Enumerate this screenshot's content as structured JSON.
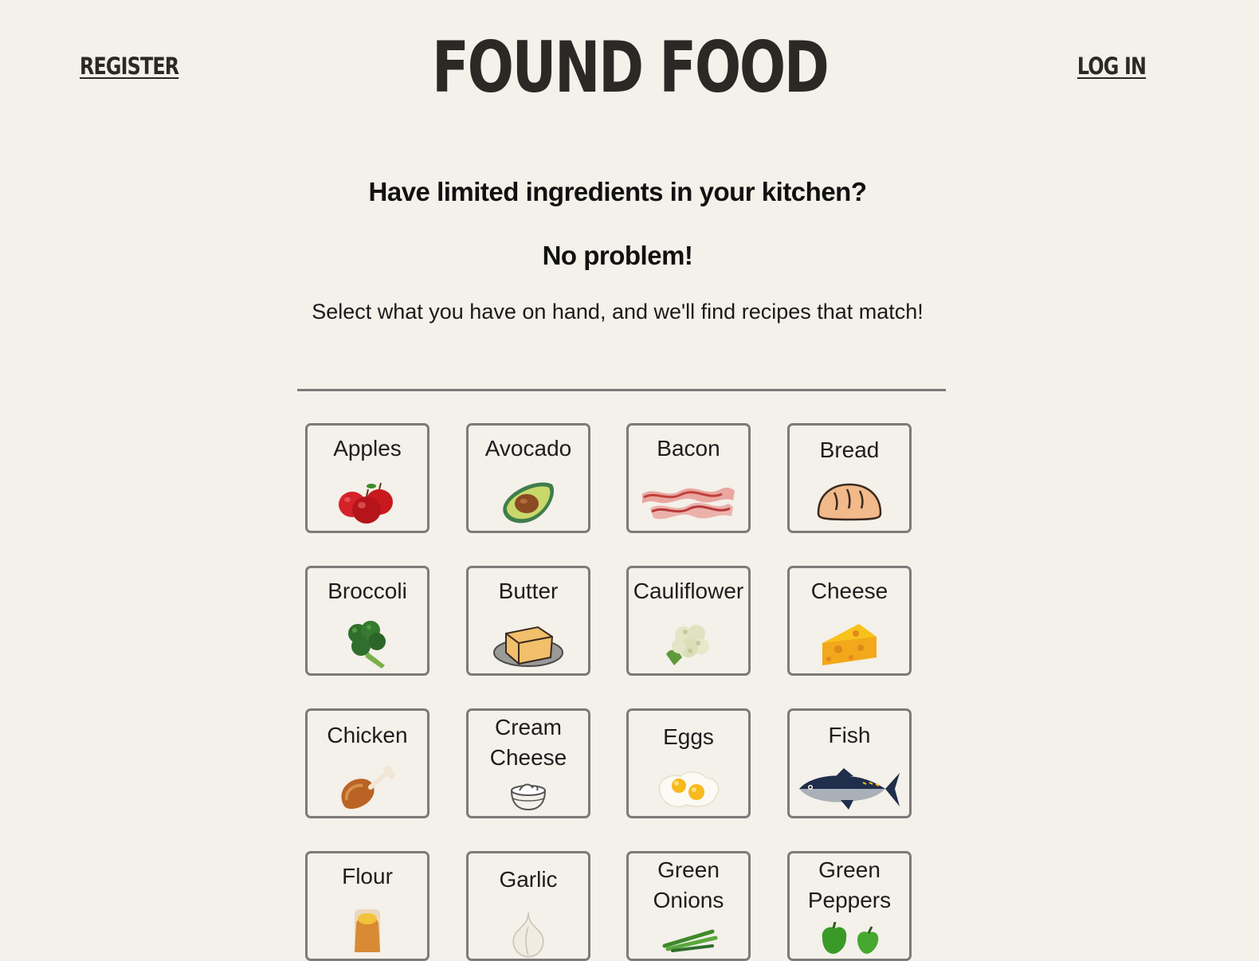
{
  "nav": {
    "register": "REGISTER",
    "login": "LOG IN"
  },
  "brand": {
    "title": "FOUND FOOD"
  },
  "hero": {
    "question": "Have limited ingredients in your kitchen?",
    "answer": "No problem!",
    "subtitle": "Select what you have on hand, and we'll find recipes that match!"
  },
  "ingredients": [
    {
      "label": "Apples",
      "icon": "apples-icon"
    },
    {
      "label": "Avocado",
      "icon": "avocado-icon"
    },
    {
      "label": "Bacon",
      "icon": "bacon-icon"
    },
    {
      "label": "Bread",
      "icon": "bread-icon"
    },
    {
      "label": "Broccoli",
      "icon": "broccoli-icon"
    },
    {
      "label": "Butter",
      "icon": "butter-icon"
    },
    {
      "label": "Cauliflower",
      "icon": "cauliflower-icon"
    },
    {
      "label": "Cheese",
      "icon": "cheese-icon"
    },
    {
      "label": "Chicken",
      "icon": "chicken-leg-icon"
    },
    {
      "label": "Cream\nCheese",
      "icon": "cream-cheese-icon"
    },
    {
      "label": "Eggs",
      "icon": "fried-eggs-icon"
    },
    {
      "label": "Fish",
      "icon": "fish-icon"
    },
    {
      "label": "Flour",
      "icon": "flour-sack-icon"
    },
    {
      "label": "Garlic",
      "icon": "garlic-icon"
    },
    {
      "label": "Green\nOnions",
      "icon": "green-onions-icon"
    },
    {
      "label": "Green\nPeppers",
      "icon": "green-peppers-icon"
    }
  ],
  "colors": {
    "background": "#f4f0ea",
    "text": "#2a2926",
    "card_border": "#7b7b79"
  }
}
